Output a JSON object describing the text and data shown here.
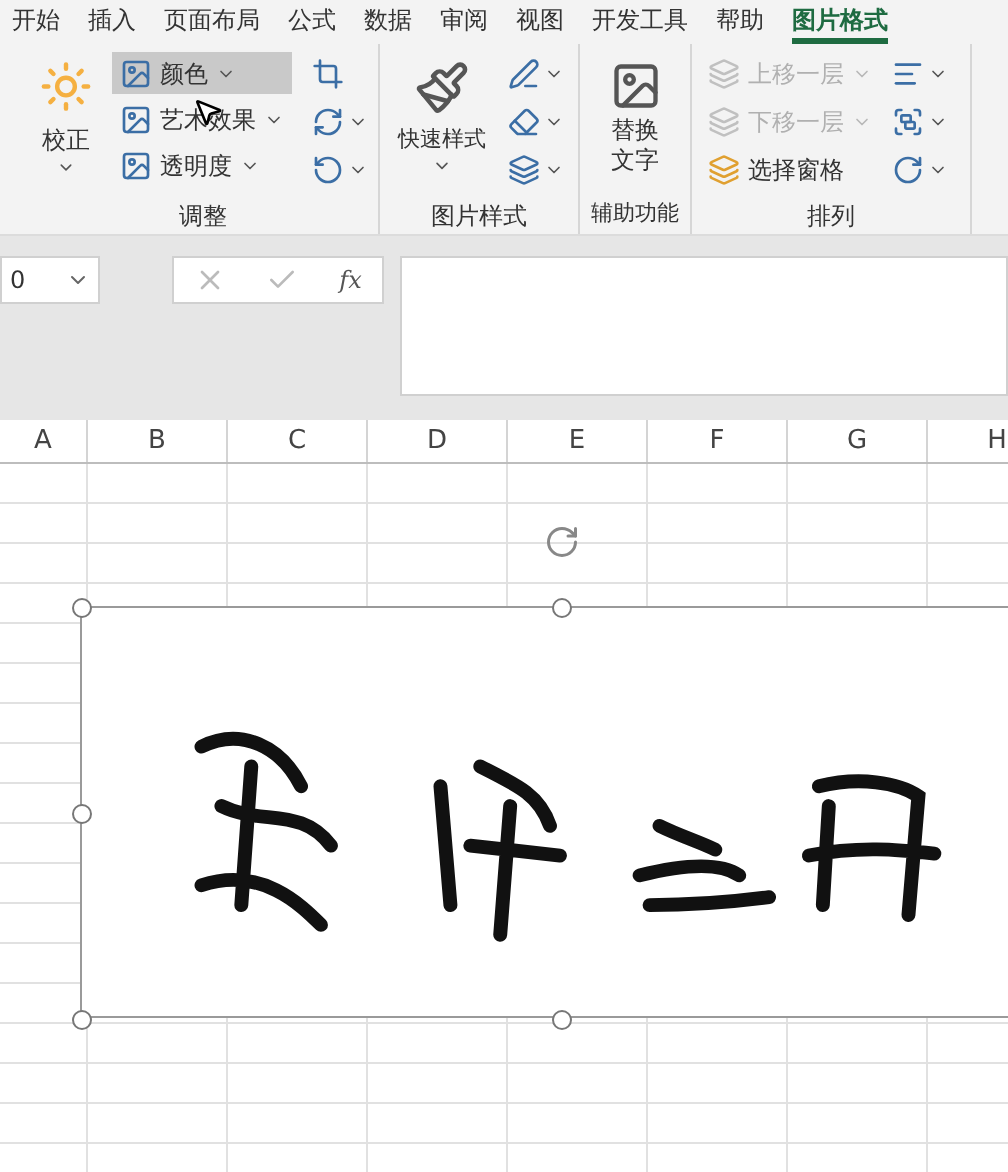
{
  "menu_tabs": [
    {
      "label": "开始",
      "selected": false
    },
    {
      "label": "插入",
      "selected": false
    },
    {
      "label": "页面布局",
      "selected": false
    },
    {
      "label": "公式",
      "selected": false
    },
    {
      "label": "数据",
      "selected": false
    },
    {
      "label": "审阅",
      "selected": false
    },
    {
      "label": "视图",
      "selected": false
    },
    {
      "label": "开发工具",
      "selected": false
    },
    {
      "label": "帮助",
      "selected": false
    },
    {
      "label": "图片格式",
      "selected": true
    }
  ],
  "ribbon": {
    "adjust": {
      "label": "调整",
      "correct": "校正",
      "items": [
        {
          "label": "颜色",
          "hover": true
        },
        {
          "label": "艺术效果",
          "hover": false
        },
        {
          "label": "透明度",
          "hover": false
        }
      ]
    },
    "styles": {
      "label": "图片样式",
      "quick": "快速样式"
    },
    "accessibility": {
      "label": "辅助功能",
      "alt_text": "替换文字"
    },
    "arrange": {
      "label": "排列",
      "items": [
        {
          "label": "上移一层",
          "disabled": true
        },
        {
          "label": "下移一层",
          "disabled": true
        },
        {
          "label": "选择窗格",
          "disabled": false
        }
      ]
    }
  },
  "formula_bar": {
    "name_box": "0",
    "fx": "fx"
  },
  "columns": [
    "A",
    "B",
    "C",
    "D",
    "E",
    "F",
    "G",
    "H"
  ]
}
